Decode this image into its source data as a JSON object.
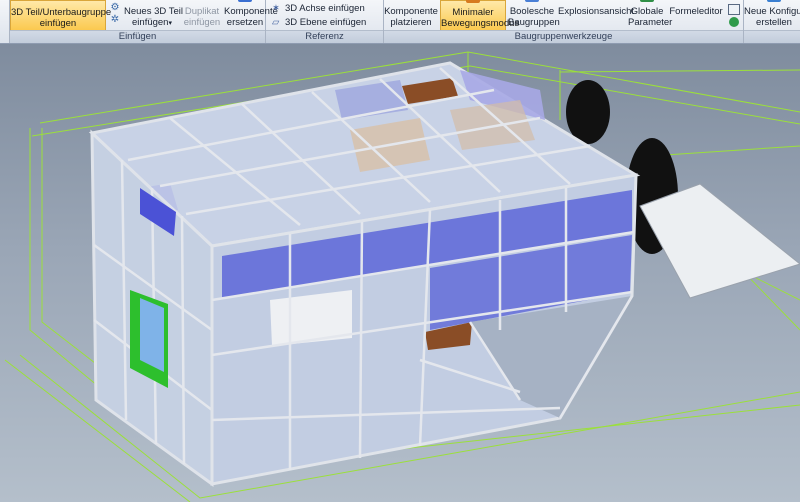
{
  "ribbon": {
    "groups": {
      "einfuegen": {
        "label": "Einfügen",
        "teil_unterbaugruppe": [
          "3D Teil/Unterbaugruppe",
          "einfügen"
        ],
        "neues_3d_teil": [
          "Neues 3D Teil",
          "einfügen"
        ],
        "duplikat": [
          "Duplikat",
          "einfügen"
        ],
        "komponente_ersetzen": [
          "Komponente",
          "ersetzen"
        ]
      },
      "referenz": {
        "label": "Referenz",
        "achse": "3D Achse einfügen",
        "ebene": "3D Ebene einfügen"
      },
      "baugruppenwerkzeuge": {
        "label": "Baugruppenwerkzeuge",
        "komponente_platzieren": [
          "Komponente",
          "platzieren"
        ],
        "minimaler_bewegungsmodus": [
          "Minimaler",
          "Bewegungsmodus"
        ],
        "boolesche_baugruppen": [
          "Boolesche",
          "Baugruppen"
        ],
        "explosionsansicht": "Explosionsansicht",
        "globale_parameter": [
          "Globale",
          "Parameter"
        ],
        "formeleditor": "Formeleditor"
      },
      "konfiguration": {
        "neue_konfiguration": [
          "Neue Konfigur",
          "erstellen"
        ]
      }
    },
    "colors": {
      "active_button": "#fbc94f",
      "group_label_bg": "#c8d1de"
    }
  },
  "viewport": {
    "colors": {
      "background_top": "#7f8c9e",
      "background_bottom": "#b4bfcb",
      "wireframe": "#9be03a",
      "frame": "#d9dde4",
      "panel_glass": "#c9d5ea",
      "panel_blue": "#5d66d8",
      "panel_brown": "#8a4d26",
      "panel_green": "#2dbf2d",
      "wheel": "#111111",
      "ramp": "#e8ebee"
    }
  }
}
